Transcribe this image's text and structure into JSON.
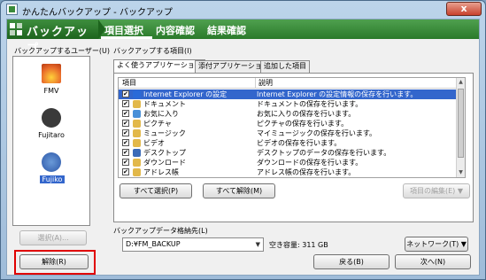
{
  "window": {
    "title": "かんたんバックアップ - バックアップ",
    "close_label": "x"
  },
  "banner": {
    "title": "バックアップ",
    "steps": [
      "項目選択",
      "内容確認",
      "結果確認"
    ],
    "active_step": 0
  },
  "users_panel": {
    "label": "バックアップするユーザー(U)",
    "users": [
      {
        "name": "FMV",
        "color": "#e86a2a"
      },
      {
        "name": "Fujitaro",
        "color": "#333333"
      },
      {
        "name": "Fujiko",
        "color": "#2c57a8",
        "selected": true
      }
    ],
    "select_button": "選択(A)...",
    "remove_button": "解除(R)"
  },
  "items_panel": {
    "label": "バックアップする項目(I)",
    "tabs": [
      "よく使うアプリケーション",
      "添付アプリケーション",
      "追加した項目"
    ],
    "active_tab": 0,
    "columns": [
      "項目",
      "説明"
    ],
    "rows": [
      {
        "name": "Internet Explorer の設定",
        "desc": "Internet Explorer の設定情報の保存を行います。",
        "icon": "ie-icon",
        "color": "#2a6ad8",
        "selected": true
      },
      {
        "name": "ドキュメント",
        "desc": "ドキュメントの保存を行います。",
        "icon": "folder-icon",
        "color": "#e2b84a"
      },
      {
        "name": "お気に入り",
        "desc": "お気に入りの保存を行います。",
        "icon": "favorites-icon",
        "color": "#4a90d8"
      },
      {
        "name": "ピクチャ",
        "desc": "ピクチャの保存を行います。",
        "icon": "folder-icon",
        "color": "#e2b84a"
      },
      {
        "name": "ミュージック",
        "desc": "マイミュージックの保存を行います。",
        "icon": "folder-icon",
        "color": "#e2b84a"
      },
      {
        "name": "ビデオ",
        "desc": "ビデオの保存を行います。",
        "icon": "folder-icon",
        "color": "#e2b84a"
      },
      {
        "name": "デスクトップ",
        "desc": "デスクトップのデータの保存を行います。",
        "icon": "desktop-icon",
        "color": "#3a6ab8"
      },
      {
        "name": "ダウンロード",
        "desc": "ダウンロードの保存を行います。",
        "icon": "folder-icon",
        "color": "#e2b84a"
      },
      {
        "name": "アドレス帳",
        "desc": "アドレス帳の保存を行います。",
        "icon": "addressbook-icon",
        "color": "#e2b84a"
      }
    ],
    "select_all": "すべて選択(P)",
    "deselect_all": "すべて解除(M)",
    "edit_item": "項目の編集(E) ▼"
  },
  "destination": {
    "label": "バックアップデータ格納先(L)",
    "path": "D:¥FM_BACKUP",
    "free_space": "空き容量: 311 GB",
    "network_button": "ネットワーク(T) ▼"
  },
  "nav": {
    "back": "戻る(B)",
    "next": "次へ(N)"
  }
}
